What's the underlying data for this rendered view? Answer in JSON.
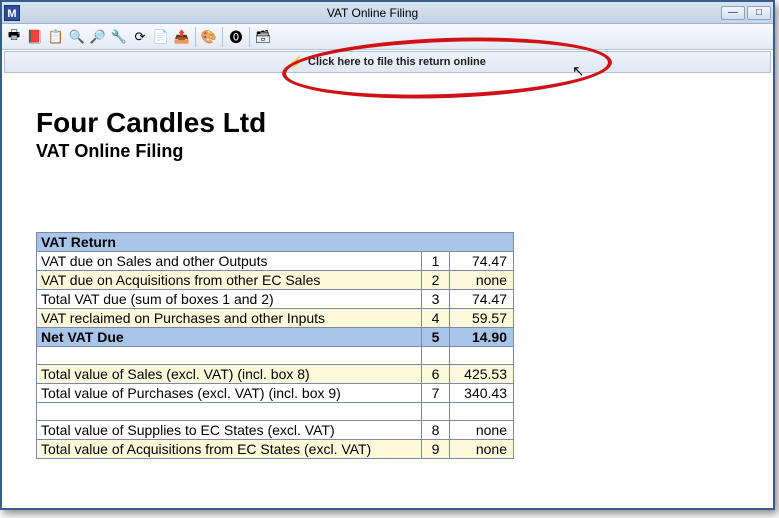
{
  "window": {
    "title": "VAT Online Filing",
    "app_icon_letter": "M"
  },
  "toolbar": {
    "icons": [
      {
        "name": "print-icon",
        "glyph": "🖶"
      },
      {
        "name": "pdf-icon",
        "glyph": "📕"
      },
      {
        "name": "clipboard-icon",
        "glyph": "📋"
      },
      {
        "name": "zoom-out-icon",
        "glyph": "🔍"
      },
      {
        "name": "zoom-in-icon",
        "glyph": "🔎"
      },
      {
        "name": "tools-icon",
        "glyph": "🔧"
      },
      {
        "name": "refresh-icon",
        "glyph": "⟳"
      },
      {
        "name": "copy-icon",
        "glyph": "📄"
      },
      {
        "name": "export-icon",
        "glyph": "📤"
      },
      {
        "name": "palette-icon",
        "glyph": "🎨"
      },
      {
        "name": "zero-icon",
        "glyph": "⓿"
      },
      {
        "name": "filter-icon",
        "glyph": "🗃"
      }
    ]
  },
  "linkbar": {
    "text": "Click here to file this return online"
  },
  "report": {
    "company": "Four Candles Ltd",
    "subtitle": "VAT Online Filing"
  },
  "table": {
    "header": "VAT Return",
    "rows1": [
      {
        "desc": "VAT due on Sales and other Outputs",
        "box": "1",
        "val": "74.47",
        "alt": false
      },
      {
        "desc": "VAT due on Acquisitions from other EC Sales",
        "box": "2",
        "val": "none",
        "alt": true
      },
      {
        "desc": "Total VAT due (sum of boxes 1 and 2)",
        "box": "3",
        "val": "74.47",
        "alt": false
      },
      {
        "desc": "VAT reclaimed on Purchases and other Inputs",
        "box": "4",
        "val": "59.57",
        "alt": true
      }
    ],
    "net": {
      "desc": "Net VAT Due",
      "box": "5",
      "val": "14.90"
    },
    "rows2": [
      {
        "desc": "Total value of Sales (excl. VAT) (incl. box 8)",
        "box": "6",
        "val": "425.53",
        "alt": true
      },
      {
        "desc": "Total value of Purchases (excl. VAT) (incl. box 9)",
        "box": "7",
        "val": "340.43",
        "alt": false
      }
    ],
    "rows3": [
      {
        "desc": "Total value of Supplies to EC States (excl. VAT)",
        "box": "8",
        "val": "none",
        "alt": false
      },
      {
        "desc": "Total value of Acquisitions from EC States (excl. VAT)",
        "box": "9",
        "val": "none",
        "alt": true
      }
    ]
  }
}
